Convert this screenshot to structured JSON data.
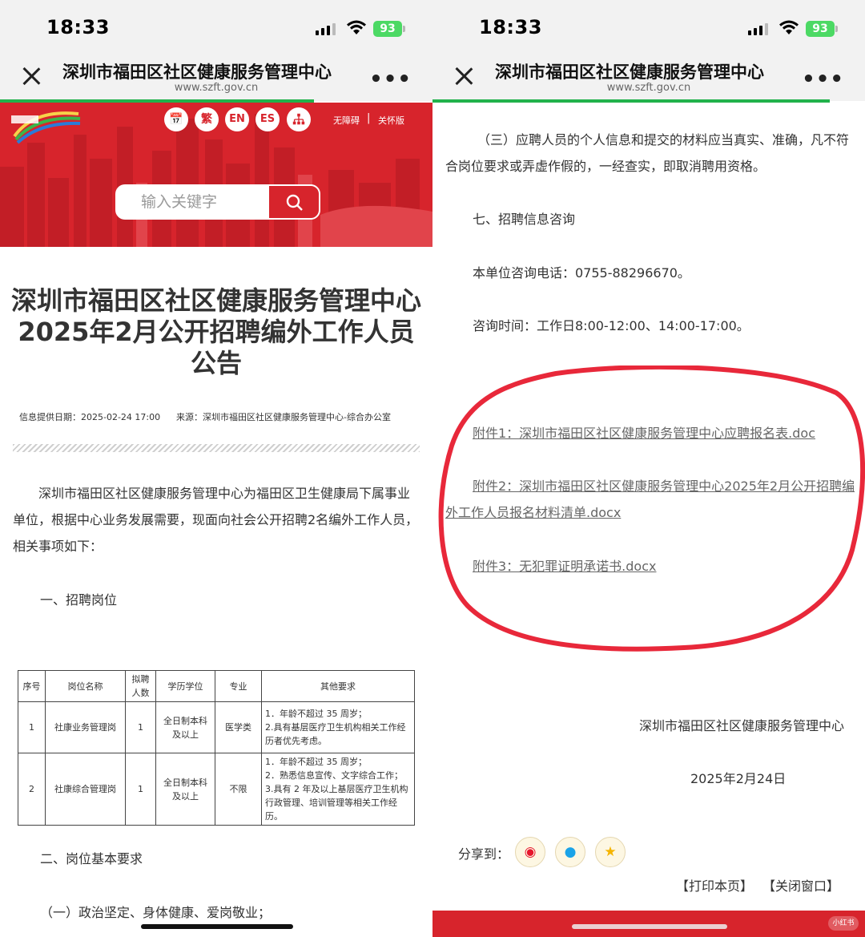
{
  "status_bar": {
    "time": "18:33",
    "battery": "93"
  },
  "nav": {
    "title": "深圳市福田区社区健康服务管理中心",
    "domain": "www.szft.gov.cn",
    "more": "•••"
  },
  "banner": {
    "buttons": [
      "繁",
      "EN",
      "ES"
    ],
    "accessibility_label": "无障碍",
    "care_label": "关怀版",
    "search_placeholder": "输入关键字"
  },
  "article": {
    "title": "深圳市福田区社区健康服务管理中心2025年2月公开招聘编外工作人员公告",
    "info_date": "信息提供日期：2025-02-24 17:00",
    "source": "来源：深圳市福田区社区健康服务管理中心-综合办公室",
    "intro": "深圳市福田区社区健康服务管理中心为福田区卫生健康局下属事业单位，根据中心业务发展需要，现面向社会公开招聘2名编外工作人员，相关事项如下：",
    "section1": "一、招聘岗位",
    "section2": "二、岗位基本要求",
    "item1": "（一）政治坚定、身体健康、爱岗敬业；"
  },
  "table": {
    "headers": [
      "序号",
      "岗位名称",
      "拟聘人数",
      "学历学位",
      "专业",
      "其他要求"
    ],
    "rows": [
      {
        "no": "1",
        "post": "社康业务管理岗",
        "count": "1",
        "edu": "全日制本科及以上",
        "major": "医学类",
        "req": [
          "1．年龄不超过 35 周岁；",
          "2.具有基层医疗卫生机构相关工作经历者优先考虑。"
        ]
      },
      {
        "no": "2",
        "post": "社康综合管理岗",
        "count": "1",
        "edu": "全日制本科及以上",
        "major": "不限",
        "req": [
          "1．年龄不超过 35 周岁；",
          "2．熟悉信息宣传、文字综合工作；",
          "3.具有 2 年及以上基层医疗卫生机构行政管理、培训管理等相关工作经历。"
        ]
      }
    ]
  },
  "right": {
    "p_three": "（三）应聘人员的个人信息和提交的材料应当真实、准确，凡不符合岗位要求或弄虚作假的，一经查实，即取消聘用资格。",
    "section7": "七、招聘信息咨询",
    "phone": "本单位咨询电话：0755-88296670。",
    "hours": "咨询时间：工作日8:00-12:00、14:00-17:00。",
    "attachments": [
      "附件1：深圳市福田区社区健康服务管理中心应聘报名表.doc",
      "附件2：深圳市福田区社区健康服务管理中心2025年2月公开招聘编外工作人员报名材料清单.docx",
      "附件3：无犯罪证明承诺书.docx"
    ],
    "signature_org": "深圳市福田区社区健康服务管理中心",
    "signature_date": "2025年2月24日",
    "share_label": "分享到：",
    "print_link": "【打印本页】",
    "close_link": "【关闭窗口】",
    "watermark": "小红书"
  },
  "colors": {
    "brand_red": "#d7242c",
    "progress_green": "#21b24b",
    "annotation_red": "#e8283a"
  }
}
